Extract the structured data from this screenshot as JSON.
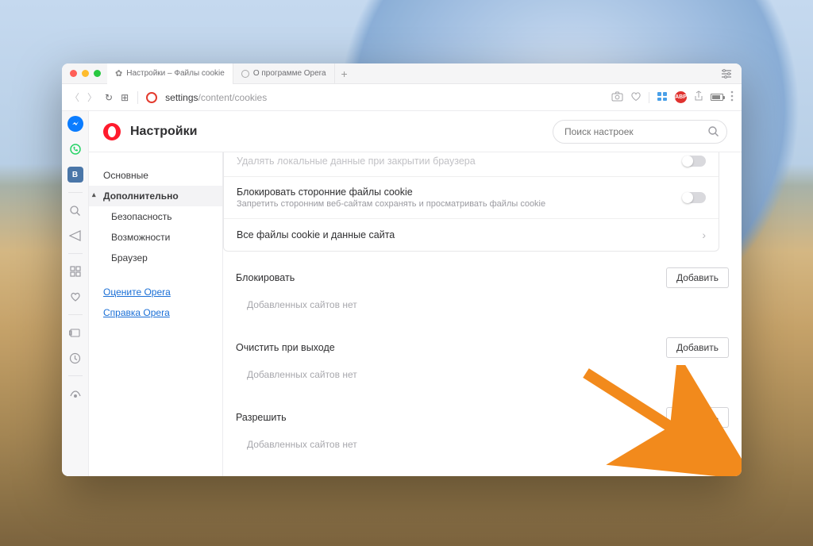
{
  "tabs": [
    {
      "label": "Настройки – Файлы cookie"
    },
    {
      "label": "О программе Opera"
    }
  ],
  "addressbar": {
    "prefix": "settings",
    "path": "/content/cookies",
    "abp": "ABP"
  },
  "header": {
    "title": "Настройки"
  },
  "search": {
    "placeholder": "Поиск настроек"
  },
  "sidenav": {
    "basic": "Основные",
    "advanced": "Дополнительно",
    "security": "Безопасность",
    "features": "Возможности",
    "browser": "Браузер",
    "rate": "Оцените Opera",
    "help": "Справка Opera"
  },
  "pane": {
    "truncated_top": "Удалять локальные данные при закрытии браузера",
    "block_third": {
      "title": "Блокировать сторонние файлы cookie",
      "desc": "Запретить сторонним веб-сайтам сохранять и просматривать файлы cookie"
    },
    "all_cookies": "Все файлы cookie и данные сайта",
    "block": {
      "label": "Блокировать",
      "empty": "Добавленных сайтов нет",
      "btn": "Добавить"
    },
    "clear": {
      "label": "Очистить при выходе",
      "empty": "Добавленных сайтов нет",
      "btn": "Добавить"
    },
    "allow": {
      "label": "Разрешить",
      "empty": "Добавленных сайтов нет",
      "btn": "Добавить"
    }
  }
}
